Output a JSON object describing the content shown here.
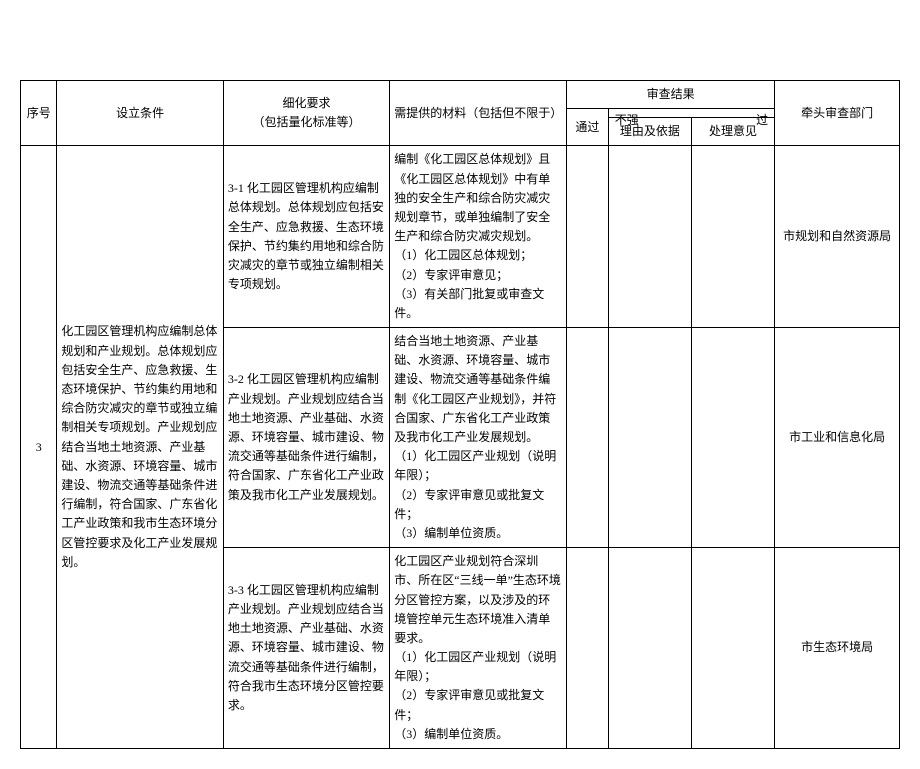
{
  "headers": {
    "seq": "序号",
    "condition": "设立条件",
    "detail": "细化要求\n（包括量化标准等）",
    "materials": "需提供的材料（包括但不限于）",
    "review_result": "审查结果",
    "pass": "通过",
    "not_strong": "不强",
    "guo": "过",
    "reason": "理由及依据",
    "action": "处理意见",
    "lead_dept": "牵头审查部门"
  },
  "row_seq": "3",
  "condition_main": "化工园区管理机构应编制总体规划和产业规划。总体规划应包括安全生产、应急救援、生态环境保护、节约集约用地和综合防灾减灾的章节或独立编制相关专项规划。产业规划应结合当地土地资源、产业基础、水资源、环境容量、城市建设、物流交通等基础条件进行编制，符合国家、广东省化工产业政策和我市生态环境分区管控要求及化工产业发展规划。",
  "rows": [
    {
      "detail": "3-1 化工园区管理机构应编制总体规划。总体规划应包括安全生产、应急救援、生态环境保护、节约集约用地和综合防灾减灾的章节或独立编制相关专项规划。",
      "materials": "编制《化工园区总体规划》且《化工园区总体规划》中有单独的安全生产和综合防灾减灾规划章节，或单独编制了安全生产和综合防灾减灾规划。\n（1）化工园区总体规划；\n（2）专家评审意见；\n（3）有关部门批复或审查文件。",
      "dept": "市规划和自然资源局"
    },
    {
      "detail": "3-2 化工园区管理机构应编制产业规划。产业规划应结合当地土地资源、产业基础、水资源、环境容量、城市建设、物流交通等基础条件进行编制，符合国家、广东省化工产业政策及我市化工产业发展规划。",
      "materials": "结合当地土地资源、产业基础、水资源、环境容量、城市建设、物流交通等基础条件编制《化工园区产业规划》，并符合国家、广东省化工产业政策及我市化工产业发展规划。\n（1）化工园区产业规划（说明年限）；\n（2）专家评审意见或批复文件；\n（3）编制单位资质。",
      "dept": "市工业和信息化局"
    },
    {
      "detail": "3-3 化工园区管理机构应编制产业规划。产业规划应结合当地土地资源、产业基础、水资源、环境容量、城市建设、物流交通等基础条件进行编制，符合我市生态环境分区管控要求。",
      "materials": "化工园区产业规划符合深圳市、所在区“三线一单”生态环境分区管控方案，以及涉及的环境管控单元生态环境准入清单要求。\n（1）化工园区产业规划（说明年限）；\n（2）专家评审意见或批复文件；\n（3）编制单位资质。",
      "dept": "市生态环境局"
    }
  ]
}
